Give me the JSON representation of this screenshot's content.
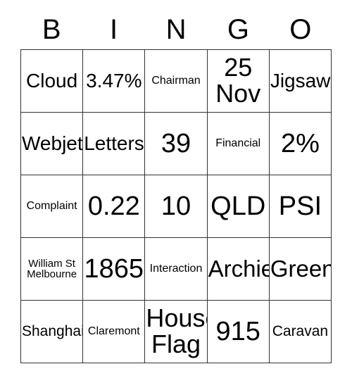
{
  "card": {
    "header": {
      "letters": [
        "B",
        "I",
        "N",
        "G",
        "O"
      ]
    },
    "columns": [
      "B",
      "I",
      "N",
      "G",
      "O"
    ],
    "rows": [
      [
        {
          "text": "Cloud",
          "size": "md"
        },
        {
          "text": "3.47%",
          "size": "md"
        },
        {
          "text": "Chairman",
          "size": "xs"
        },
        {
          "text": "25\nNov",
          "size": "two-xl"
        },
        {
          "text": "Jigsaw",
          "size": "md"
        }
      ],
      [
        {
          "text": "Webjet",
          "size": "md"
        },
        {
          "text": "Letters",
          "size": "md"
        },
        {
          "text": "39",
          "size": "xl"
        },
        {
          "text": "Financial",
          "size": "xs"
        },
        {
          "text": "2%",
          "size": "xl"
        }
      ],
      [
        {
          "text": "Complaint",
          "size": "xs"
        },
        {
          "text": "0.22",
          "size": "xl"
        },
        {
          "text": "10",
          "size": "xl"
        },
        {
          "text": "QLD",
          "size": "xl"
        },
        {
          "text": "PSI",
          "size": "xl"
        }
      ],
      [
        {
          "text": "William St\nMelbourne",
          "size": "xxs"
        },
        {
          "text": "1865",
          "size": "xl"
        },
        {
          "text": "Interaction",
          "size": "xs"
        },
        {
          "text": "Archie",
          "size": "lg"
        },
        {
          "text": "Green",
          "size": "lg"
        }
      ],
      [
        {
          "text": "Shanghai",
          "size": "sm"
        },
        {
          "text": "Claremont",
          "size": "xs"
        },
        {
          "text": "House\nFlag",
          "size": "two-xl"
        },
        {
          "text": "915",
          "size": "xl"
        },
        {
          "text": "Caravan",
          "size": "sm"
        }
      ]
    ]
  },
  "colors": {
    "background": "#ffffff",
    "text": "#000000",
    "border": "#333333"
  }
}
